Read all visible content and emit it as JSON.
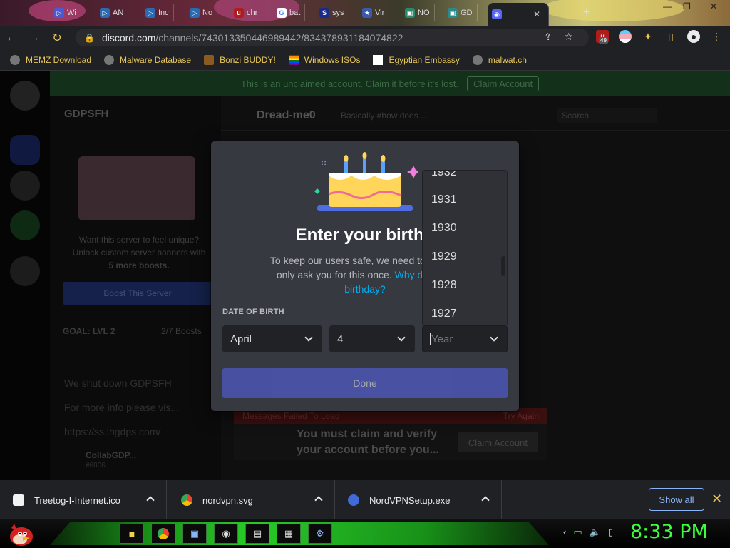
{
  "browser": {
    "tabs": [
      {
        "label": "Wi",
        "icon": "tab-icon"
      },
      {
        "label": "AN",
        "icon": "tab-icon"
      },
      {
        "label": "Inc",
        "icon": "tab-icon"
      },
      {
        "label": "No",
        "icon": "tab-icon"
      },
      {
        "label": "chr",
        "icon": "ublock-icon"
      },
      {
        "label": "bat",
        "icon": "google-icon"
      },
      {
        "label": "sys",
        "icon": "tab-icon"
      },
      {
        "label": "Vir",
        "icon": "tab-icon"
      },
      {
        "label": "NO",
        "icon": "tab-icon"
      },
      {
        "label": "GD",
        "icon": "tab-icon"
      },
      {
        "label": "",
        "icon": "discord-icon",
        "close": "✕"
      }
    ],
    "new_tab": "+",
    "url_host": "discord.com",
    "url_path": "/channels/743013350446989442/834378931184074822",
    "extension_badge": "49",
    "bookmarks": [
      "MEMZ Download",
      "Malware Database",
      "Bonzi BUDDY!",
      "Windows ISOs",
      "Egyptian Embassy",
      "malwat.ch"
    ]
  },
  "discord_bg": {
    "unclaimed_text": "This is an unclaimed account. Claim it before it's lost.",
    "claim_button": "Claim Account",
    "server_name": "GDPSFH",
    "boost_line1": "Want this server to feel unique?",
    "boost_line2": "Unlock custom server banners with",
    "boost_line3": "5 more boosts.",
    "boost_button": "Boost This Server",
    "goal": "GOAL: LVL 2",
    "goal_count": "2/7 Boosts",
    "channels": [
      "We shut down GDPSFH",
      "For more info please vis...",
      "https://ss.lhgdps.com/"
    ],
    "user": "CollabGDP...",
    "user_tag": "#6006",
    "channel_title": "Dread-me0",
    "channel_topic": "Basically #how does ...",
    "search_placeholder": "Search",
    "error_text": "Messages Failed To Load",
    "try_again": "Try Again",
    "claim_notice_l1": "You must claim and verify",
    "claim_notice_l2": "your account before you...",
    "claim_notice_button": "Claim Account"
  },
  "modal": {
    "title": "Enter your birthd",
    "desc_plain": "To keep our users safe, we need to verify your age. We'll only ask you for this once.",
    "desc_line1": "To keep our users safe, we need to verify y",
    "desc_line2": "only ask you for this once.",
    "desc_link1": "Why do I nee",
    "desc_link2": "birthday?",
    "dob_label": "DATE OF BIRTH",
    "month_value": "April",
    "day_value": "4",
    "year_placeholder": "Year",
    "year_options": [
      "1932",
      "1931",
      "1930",
      "1929",
      "1928",
      "1927"
    ],
    "done_label": "Done"
  },
  "downloads": {
    "items": [
      {
        "name": "Treetog-I-Internet.ico"
      },
      {
        "name": "nordvpn.svg"
      },
      {
        "name": "NordVPNSetup.exe"
      }
    ],
    "show_all": "Show all",
    "close": "✕"
  },
  "taskbar": {
    "clock": "8:33 PM"
  },
  "colors": {
    "discord_blurple": "#5865f2",
    "link_blue": "#00b0f4",
    "clock_green": "#3cff3c",
    "bookmark_yellow": "#e8c65a"
  }
}
